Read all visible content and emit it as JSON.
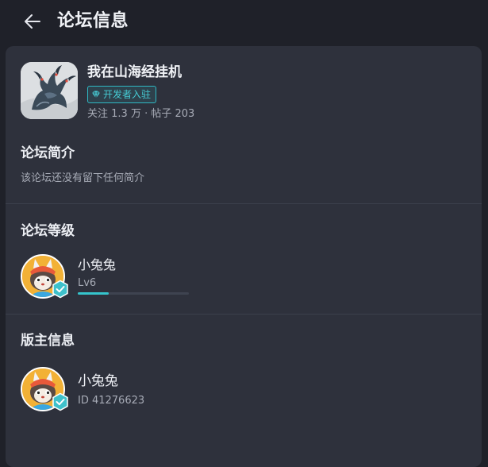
{
  "header": {
    "title": "论坛信息",
    "back_icon": "arrow-left-icon"
  },
  "forum": {
    "name": "我在山海经挂机",
    "badge": "开发者入驻",
    "badge_icon": "diamond-icon",
    "stats": "关注 1.3 万 · 帖子 203"
  },
  "intro": {
    "title": "论坛简介",
    "text": "该论坛还没有留下任何简介"
  },
  "level": {
    "title": "论坛等级",
    "user_name": "小兔兔",
    "level_label": "Lv6",
    "progress": 0.28,
    "accent": "#35c4cc"
  },
  "moderator": {
    "title": "版主信息",
    "user_name": "小兔兔",
    "user_id": "ID 41276623"
  }
}
